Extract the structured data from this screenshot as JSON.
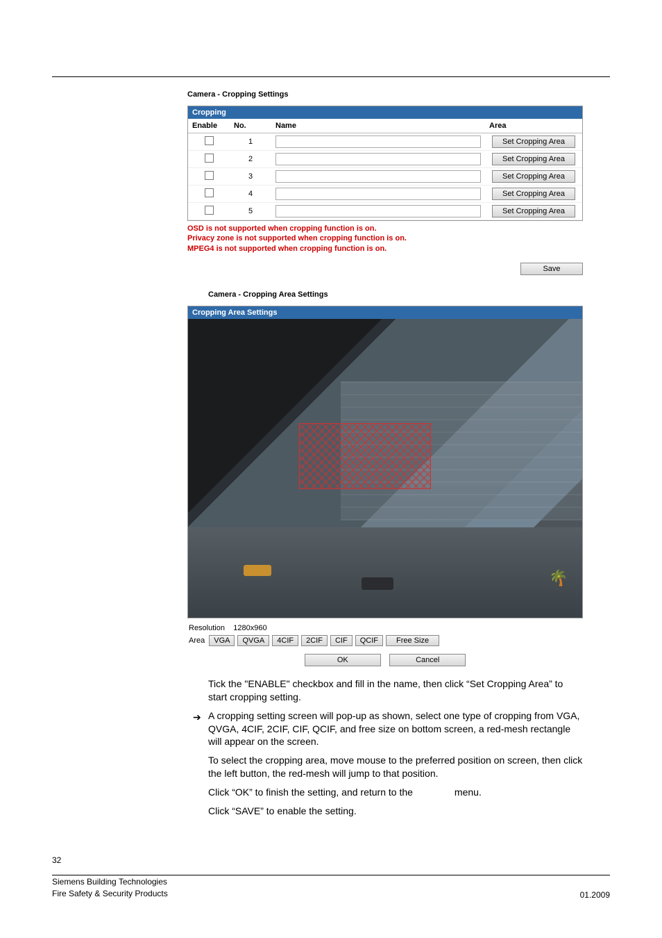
{
  "section1": {
    "title": "Camera - Cropping Settings",
    "panel_header": "Cropping",
    "headers": {
      "enable": "Enable",
      "no": "No.",
      "name": "Name",
      "area": "Area"
    },
    "rows": [
      {
        "no": "1",
        "btn": "Set Cropping Area"
      },
      {
        "no": "2",
        "btn": "Set Cropping Area"
      },
      {
        "no": "3",
        "btn": "Set Cropping Area"
      },
      {
        "no": "4",
        "btn": "Set Cropping Area"
      },
      {
        "no": "5",
        "btn": "Set Cropping Area"
      }
    ],
    "warnings": [
      "OSD is not supported when cropping function is on.",
      "Privacy zone is not supported when cropping function is on.",
      "MPEG4 is not supported when cropping function is on."
    ],
    "save_label": "Save"
  },
  "section2": {
    "title": "Camera - Cropping Area Settings",
    "panel_header": "Cropping Area Settings",
    "resolution_label": "Resolution",
    "resolution_value": "1280x960",
    "area_label": "Area",
    "presets": [
      "VGA",
      "QVGA",
      "4CIF",
      "2CIF",
      "CIF",
      "QCIF",
      "Free Size"
    ],
    "ok_label": "OK",
    "cancel_label": "Cancel"
  },
  "body": {
    "p1": "Tick the \"ENABLE\" checkbox and fill in the name, then click “Set Cropping Area” to start cropping setting.",
    "arrow": "A cropping setting screen will pop-up as shown, select one type of cropping from VGA, QVGA, 4CIF, 2CIF, CIF, QCIF, and free size on bottom screen, a red-mesh rectangle will appear on the screen.",
    "p2": "To select the cropping area, move mouse to the preferred position on screen, then click the left button, the red-mesh will jump to that position.",
    "p3a": "Click “OK” to finish the setting, and return to the",
    "p3b": "menu.",
    "p4": "Click “SAVE” to enable the setting."
  },
  "footer": {
    "page": "32",
    "left1": "Siemens Building Technologies",
    "left2": "Fire Safety & Security Products",
    "right": "01.2009"
  }
}
